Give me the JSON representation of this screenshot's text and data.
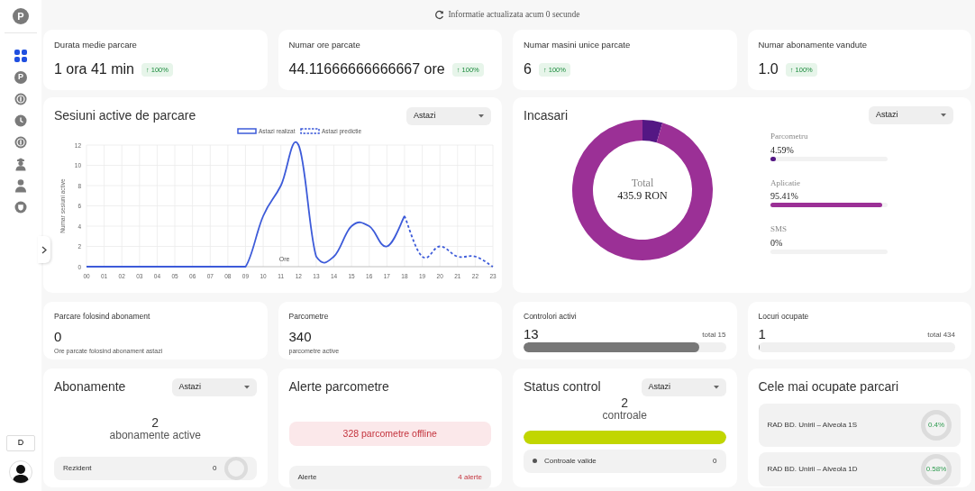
{
  "sidebar": {
    "logo": "P",
    "nav": [
      {
        "selected": true
      },
      {
        "glyph": "P",
        "selected": false
      },
      {
        "selected": false
      },
      {
        "selected": false
      },
      {
        "selected": false
      },
      {
        "selected": false
      },
      {
        "selected": false
      },
      {
        "selected": false
      }
    ],
    "user_initial": "D"
  },
  "refresh_note": "Informatie actualizata acum 0 secunde",
  "kpis": [
    {
      "title": "Durata medie parcare",
      "value": "1 ora 41 min",
      "trend": "↑ 100%"
    },
    {
      "title": "Numar ore parcate",
      "value": "44.11666666666667 ore",
      "trend": "↑ 100%"
    },
    {
      "title": "Numar masini unice parcate",
      "value": "6",
      "trend": "↑ 100%"
    },
    {
      "title": "Numar abonamente vandute",
      "value": "1.0",
      "trend": "↑ 100%"
    }
  ],
  "sessions": {
    "title": "Sesiuni active de parcare",
    "period": "Astazi",
    "chart_data": {
      "type": "line",
      "xlabel": "Ore",
      "ylabel": "Numar sesiuni active",
      "categories": [
        "00",
        "01",
        "02",
        "03",
        "04",
        "05",
        "06",
        "07",
        "08",
        "09",
        "10",
        "11",
        "12",
        "13",
        "14",
        "15",
        "16",
        "17",
        "18",
        "19",
        "20",
        "21",
        "22",
        "23"
      ],
      "ylim": [
        0,
        12
      ],
      "grid": true,
      "legend": true,
      "yticks": [
        0,
        2,
        4,
        6,
        8,
        10,
        12
      ],
      "series": [
        {
          "name": "Astazi realizat",
          "color": "#3d5bd9",
          "line_style": "solid",
          "values": [
            0,
            0,
            0,
            0,
            0,
            0,
            0,
            0,
            0,
            0,
            5,
            8,
            12,
            1,
            1,
            4,
            4,
            2,
            5,
            null,
            null,
            null,
            null,
            null
          ]
        },
        {
          "name": "Astazi predictie",
          "color": "#3d5bd9",
          "line_style": "dashed",
          "values": [
            null,
            null,
            null,
            null,
            null,
            null,
            null,
            null,
            null,
            null,
            null,
            null,
            null,
            null,
            null,
            null,
            null,
            null,
            5,
            1,
            2,
            1,
            1,
            0
          ]
        }
      ]
    }
  },
  "incasari": {
    "title": "Incasari",
    "period": "Astazi",
    "total_label": "Total",
    "total_value": "435.9 RON",
    "chart_data": {
      "type": "donut",
      "categories": [
        "Parcometru",
        "Aplicatie",
        "SMS"
      ],
      "values": [
        4.59,
        95.41,
        0
      ]
    },
    "legend": [
      {
        "reading": "4.59%",
        "level": 0.0459,
        "color": "#541784"
      },
      {
        "reading": "95.41%",
        "level": 0.9541,
        "color": "#9b3096"
      },
      {
        "reading": "0%"
      }
    ]
  },
  "stats": [
    {
      "kind": "note",
      "title": "Parcare folosind abonament",
      "value": "0",
      "note": "Ore parcate folosind abonament astazi"
    },
    {
      "kind": "note",
      "title": "Parcometre",
      "value": "340",
      "note": "parcometre active"
    },
    {
      "kind": "meter",
      "title": "Controlori activi",
      "value": "13",
      "total": "total 15",
      "level": 0.867
    },
    {
      "kind": "meter",
      "title": "Locuri ocupate",
      "value": "1",
      "total": "total 434",
      "level": 0.0023
    }
  ],
  "abonamente": {
    "title": "Abonamente",
    "period": "Astazi",
    "count": "2",
    "caption": "abonamente active",
    "items": [
      {
        "label": "Rezident",
        "value": "0"
      }
    ]
  },
  "alerte": {
    "title": "Alerte parcometre",
    "alert": "328 parcometre offline",
    "items": [
      {
        "label": "Alerte",
        "value": "4 alerte"
      }
    ]
  },
  "status_control": {
    "title": "Status control",
    "period": "Astazi",
    "count": "2",
    "caption": "controale",
    "level": 1,
    "items": [
      {
        "label": "Controale valide",
        "value": "0"
      }
    ]
  },
  "top_parcari": {
    "title": "Cele mai ocupate parcari",
    "items": [
      {
        "label": "RAD BD. Unirii – Alveola 1S",
        "reading": "0.4%"
      },
      {
        "label": "RAD BD. Unirii – Alveola 1D",
        "reading": "0.58%"
      }
    ]
  }
}
